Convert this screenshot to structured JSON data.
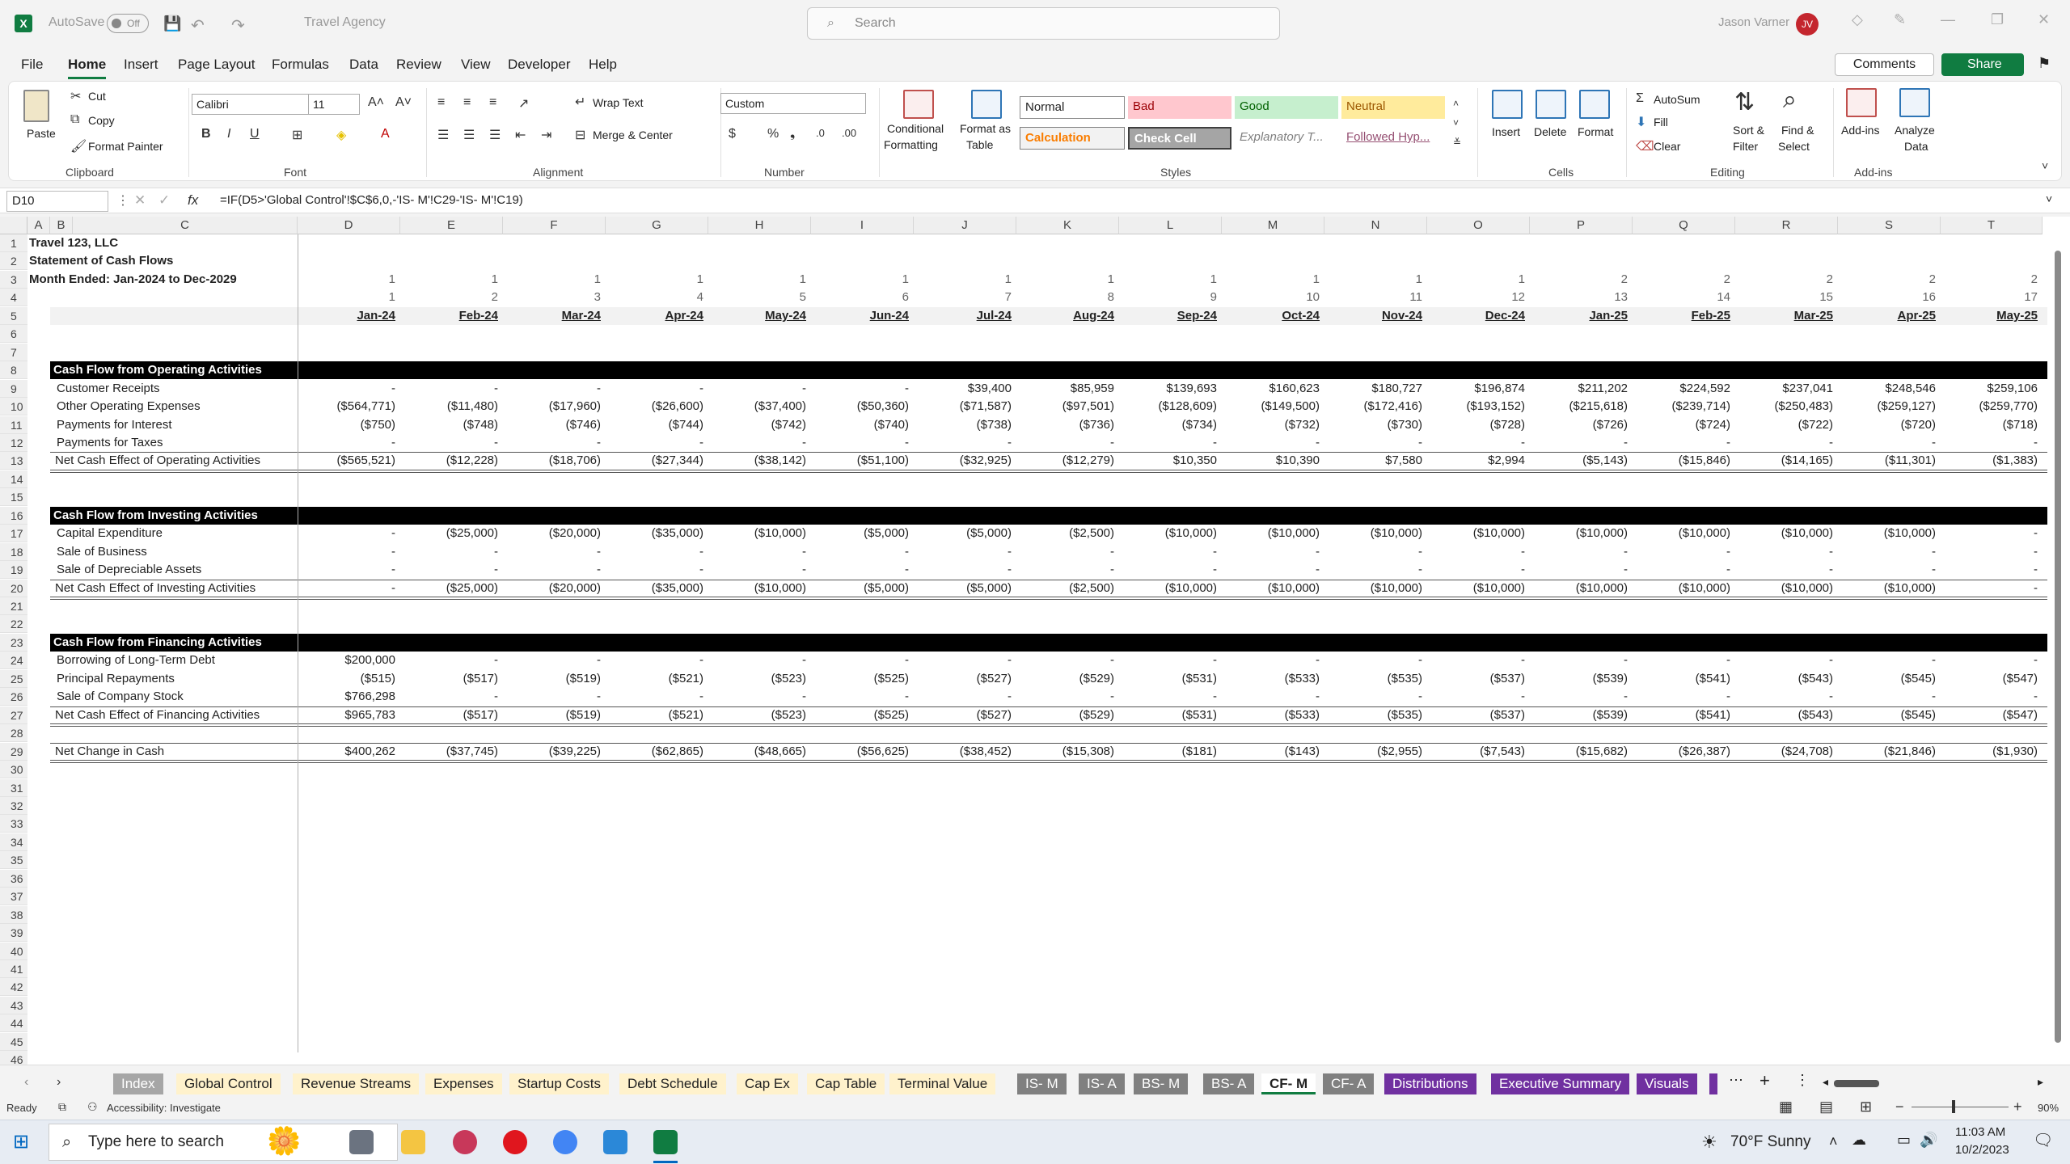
{
  "titlebar": {
    "autosave_label": "AutoSave",
    "autosave_state": "Off",
    "doc_title": "Travel Agency",
    "search_placeholder": "Search",
    "user_name": "Jason Varner",
    "user_initials": "JV"
  },
  "menu": [
    "File",
    "Home",
    "Insert",
    "Page Layout",
    "Formulas",
    "Data",
    "Review",
    "View",
    "Developer",
    "Help"
  ],
  "menu_active": "Home",
  "comments_label": "Comments",
  "share_label": "Share",
  "ribbon": {
    "clipboard": {
      "paste": "Paste",
      "cut": "Cut",
      "copy": "Copy",
      "format_painter": "Format Painter",
      "group": "Clipboard"
    },
    "font": {
      "name": "Calibri",
      "size": "11",
      "group": "Font"
    },
    "alignment": {
      "wrap": "Wrap Text",
      "merge": "Merge & Center",
      "group": "Alignment"
    },
    "number": {
      "format": "Custom",
      "group": "Number"
    },
    "styles": {
      "conditional": "Conditional",
      "formatting": "Formatting",
      "format_as": "Format as",
      "table": "Table",
      "group": "Styles",
      "cells": [
        "Normal",
        "Bad",
        "Good",
        "Neutral",
        "Calculation",
        "Check Cell",
        "Explanatory T...",
        "Followed Hyp..."
      ]
    },
    "cells": {
      "insert": "Insert",
      "delete": "Delete",
      "format": "Format",
      "group": "Cells"
    },
    "editing": {
      "autosum": "AutoSum",
      "fill": "Fill",
      "clear": "Clear",
      "sort1": "Sort &",
      "sort2": "Filter",
      "find1": "Find &",
      "find2": "Select",
      "group": "Editing"
    },
    "addins": {
      "addins": "Add-ins",
      "analyze1": "Analyze",
      "analyze2": "Data",
      "group": "Add-ins"
    }
  },
  "formula_bar": {
    "cell": "D10",
    "formula": "=IF(D5>'Global Control'!$C$6,0,-'IS- M'!C29-'IS- M'!C19)"
  },
  "columns": [
    "A",
    "B",
    "C",
    "D",
    "E",
    "F",
    "G",
    "H",
    "I",
    "J",
    "K",
    "L",
    "M",
    "N",
    "O",
    "P",
    "Q",
    "R",
    "S",
    "T"
  ],
  "sheet": {
    "title1": "Travel 123, LLC",
    "title2": "Statement of Cash Flows",
    "title3": "Month Ended: Jan-2024 to Dec-2029",
    "row3": [
      "1",
      "1",
      "1",
      "1",
      "1",
      "1",
      "1",
      "1",
      "1",
      "1",
      "1",
      "1",
      "2",
      "2",
      "2",
      "2",
      "2"
    ],
    "row4": [
      "1",
      "2",
      "3",
      "4",
      "5",
      "6",
      "7",
      "8",
      "9",
      "10",
      "11",
      "12",
      "13",
      "14",
      "15",
      "16",
      "17"
    ],
    "months": [
      "Jan-24",
      "Feb-24",
      "Mar-24",
      "Apr-24",
      "May-24",
      "Jun-24",
      "Jul-24",
      "Aug-24",
      "Sep-24",
      "Oct-24",
      "Nov-24",
      "Dec-24",
      "Jan-25",
      "Feb-25",
      "Mar-25",
      "Apr-25",
      "May-25"
    ],
    "sections": [
      {
        "header": "Cash Flow from Operating Activities",
        "header_row": 8,
        "rows": [
          {
            "row": 9,
            "label": "Customer Receipts",
            "values": [
              "-",
              "-",
              "-",
              "-",
              "-",
              "-",
              "$39,400",
              "$85,959",
              "$139,693",
              "$160,623",
              "$180,727",
              "$196,874",
              "$211,202",
              "$224,592",
              "$237,041",
              "$248,546",
              "$259,106"
            ]
          },
          {
            "row": 10,
            "label": "Other Operating Expenses",
            "values": [
              "($564,771)",
              "($11,480)",
              "($17,960)",
              "($26,600)",
              "($37,400)",
              "($50,360)",
              "($71,587)",
              "($97,501)",
              "($128,609)",
              "($149,500)",
              "($172,416)",
              "($193,152)",
              "($215,618)",
              "($239,714)",
              "($250,483)",
              "($259,127)",
              "($259,770)"
            ]
          },
          {
            "row": 11,
            "label": "Payments for Interest",
            "values": [
              "($750)",
              "($748)",
              "($746)",
              "($744)",
              "($742)",
              "($740)",
              "($738)",
              "($736)",
              "($734)",
              "($732)",
              "($730)",
              "($728)",
              "($726)",
              "($724)",
              "($722)",
              "($720)",
              "($718)"
            ]
          },
          {
            "row": 12,
            "label": "Payments for Taxes",
            "values": [
              "-",
              "-",
              "-",
              "-",
              "-",
              "-",
              "-",
              "-",
              "-",
              "-",
              "-",
              "-",
              "-",
              "-",
              "-",
              "-",
              "-"
            ]
          }
        ],
        "total": {
          "row": 13,
          "label": "Net Cash Effect of Operating Activities",
          "values": [
            "($565,521)",
            "($12,228)",
            "($18,706)",
            "($27,344)",
            "($38,142)",
            "($51,100)",
            "($32,925)",
            "($12,279)",
            "$10,350",
            "$10,390",
            "$7,580",
            "$2,994",
            "($5,143)",
            "($15,846)",
            "($14,165)",
            "($11,301)",
            "($1,383)"
          ]
        }
      },
      {
        "header": "Cash Flow from Investing Activities",
        "header_row": 16,
        "rows": [
          {
            "row": 17,
            "label": "Capital Expenditure",
            "values": [
              "-",
              "($25,000)",
              "($20,000)",
              "($35,000)",
              "($10,000)",
              "($5,000)",
              "($5,000)",
              "($2,500)",
              "($10,000)",
              "($10,000)",
              "($10,000)",
              "($10,000)",
              "($10,000)",
              "($10,000)",
              "($10,000)",
              "($10,000)",
              "-"
            ]
          },
          {
            "row": 18,
            "label": "Sale of Business",
            "values": [
              "-",
              "-",
              "-",
              "-",
              "-",
              "-",
              "-",
              "-",
              "-",
              "-",
              "-",
              "-",
              "-",
              "-",
              "-",
              "-",
              "-"
            ]
          },
          {
            "row": 19,
            "label": "Sale of Depreciable Assets",
            "values": [
              "-",
              "-",
              "-",
              "-",
              "-",
              "-",
              "-",
              "-",
              "-",
              "-",
              "-",
              "-",
              "-",
              "-",
              "-",
              "-",
              "-"
            ]
          }
        ],
        "total": {
          "row": 20,
          "label": "Net Cash Effect of Investing Activities",
          "values": [
            "-",
            "($25,000)",
            "($20,000)",
            "($35,000)",
            "($10,000)",
            "($5,000)",
            "($5,000)",
            "($2,500)",
            "($10,000)",
            "($10,000)",
            "($10,000)",
            "($10,000)",
            "($10,000)",
            "($10,000)",
            "($10,000)",
            "($10,000)",
            "-"
          ]
        }
      },
      {
        "header": "Cash Flow from Financing Activities",
        "header_row": 23,
        "rows": [
          {
            "row": 24,
            "label": "Borrowing of Long-Term Debt",
            "values": [
              "$200,000",
              "-",
              "-",
              "-",
              "-",
              "-",
              "-",
              "-",
              "-",
              "-",
              "-",
              "-",
              "-",
              "-",
              "-",
              "-",
              "-"
            ]
          },
          {
            "row": 25,
            "label": "Principal Repayments",
            "values": [
              "($515)",
              "($517)",
              "($519)",
              "($521)",
              "($523)",
              "($525)",
              "($527)",
              "($529)",
              "($531)",
              "($533)",
              "($535)",
              "($537)",
              "($539)",
              "($541)",
              "($543)",
              "($545)",
              "($547)"
            ]
          },
          {
            "row": 26,
            "label": "Sale of Company Stock",
            "values": [
              "$766,298",
              "-",
              "-",
              "-",
              "-",
              "-",
              "-",
              "-",
              "-",
              "-",
              "-",
              "-",
              "-",
              "-",
              "-",
              "-",
              "-"
            ]
          }
        ],
        "total": {
          "row": 27,
          "label": "Net Cash Effect of Financing Activities",
          "values": [
            "$965,783",
            "($517)",
            "($519)",
            "($521)",
            "($523)",
            "($525)",
            "($527)",
            "($529)",
            "($531)",
            "($533)",
            "($535)",
            "($537)",
            "($539)",
            "($541)",
            "($543)",
            "($545)",
            "($547)"
          ]
        }
      }
    ],
    "net_change": {
      "row": 29,
      "label": "Net Change in Cash",
      "values": [
        "$400,262",
        "($37,745)",
        "($39,225)",
        "($62,865)",
        "($48,665)",
        "($56,625)",
        "($38,452)",
        "($15,308)",
        "($181)",
        "($143)",
        "($2,955)",
        "($7,543)",
        "($15,682)",
        "($26,387)",
        "($24,708)",
        "($21,846)",
        "($1,930)"
      ]
    }
  },
  "tabs": [
    {
      "name": "Index",
      "color": "#a6a6a6",
      "text": "#ffffff"
    },
    {
      "name": "Global Control",
      "color": "#fff2cc",
      "text": "#222222"
    },
    {
      "name": "Revenue Streams",
      "color": "#fff2cc",
      "text": "#222222"
    },
    {
      "name": "Expenses",
      "color": "#fff2cc",
      "text": "#222222"
    },
    {
      "name": "Startup Costs",
      "color": "#fff2cc",
      "text": "#222222"
    },
    {
      "name": "Debt Schedule",
      "color": "#fff2cc",
      "text": "#222222"
    },
    {
      "name": "Cap Ex",
      "color": "#fff2cc",
      "text": "#222222"
    },
    {
      "name": "Cap Table",
      "color": "#fff2cc",
      "text": "#222222"
    },
    {
      "name": "Terminal Value",
      "color": "#fff2cc",
      "text": "#222222"
    },
    {
      "name": "IS- M",
      "color": "#808080",
      "text": "#ffffff"
    },
    {
      "name": "IS- A",
      "color": "#808080",
      "text": "#ffffff"
    },
    {
      "name": "BS- M",
      "color": "#808080",
      "text": "#ffffff"
    },
    {
      "name": "BS- A",
      "color": "#808080",
      "text": "#ffffff"
    },
    {
      "name": "CF- M",
      "color": "#ffffff",
      "text": "#222222"
    },
    {
      "name": "CF- A",
      "color": "#808080",
      "text": "#ffffff"
    },
    {
      "name": "Distributions",
      "color": "#7030a0",
      "text": "#ffffff"
    },
    {
      "name": "Executive Summary",
      "color": "#7030a0",
      "text": "#ffffff"
    },
    {
      "name": "Visuals",
      "color": "#7030a0",
      "text": "#ffffff"
    }
  ],
  "status": {
    "ready": "Ready",
    "accessibility": "Accessibility: Investigate",
    "zoom": "90%"
  },
  "taskbar": {
    "search_placeholder": "Type here to search",
    "weather": "70°F  Sunny",
    "time": "11:03 AM",
    "date": "10/2/2023"
  }
}
